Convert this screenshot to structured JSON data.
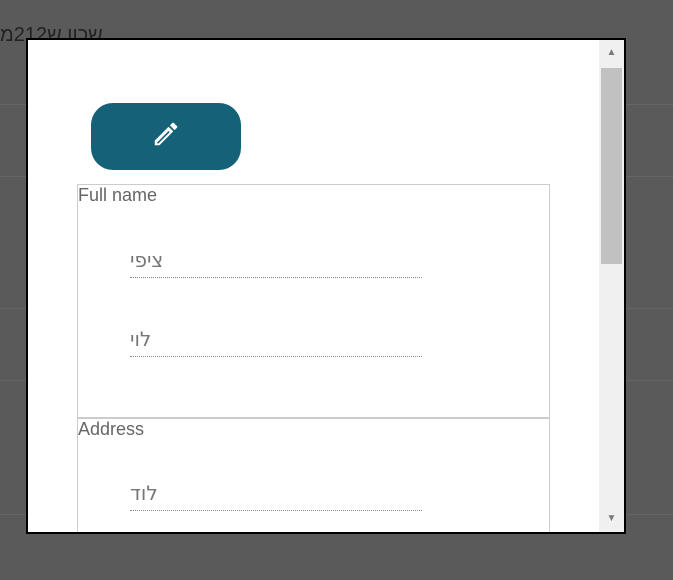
{
  "background": {
    "header_text": "שכון ש212מ"
  },
  "modal": {
    "edit_button": {
      "icon": "pencil-icon",
      "color": "#146178"
    },
    "groups": [
      {
        "title": "Full name",
        "fields": [
          {
            "value": "ציפי"
          },
          {
            "value": "לוי"
          }
        ]
      },
      {
        "title": "Address",
        "fields": [
          {
            "value": "לוד"
          }
        ]
      }
    ]
  }
}
